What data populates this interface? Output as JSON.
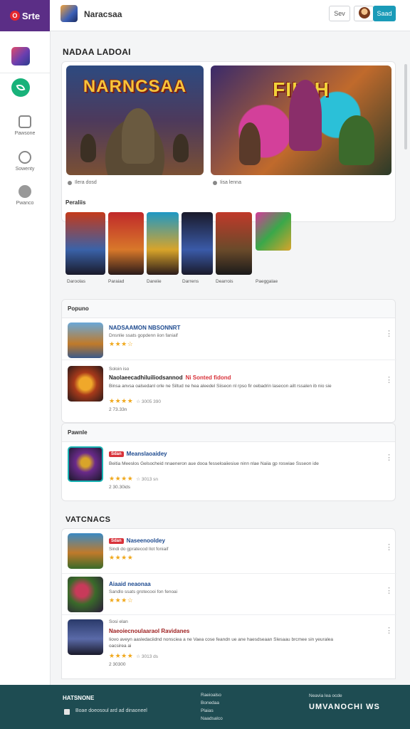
{
  "brand": {
    "name": "Srte",
    "mark": "O"
  },
  "header": {
    "app_name": "Naracsaa",
    "button_label": "Sev",
    "primary_label": "Saad"
  },
  "sidebar": {
    "items": [
      {
        "label": "Pawsone",
        "icon": "home-icon"
      },
      {
        "label": "Sowenty",
        "icon": "settings-icon"
      },
      {
        "label": "Pwanco",
        "icon": "chat-icon"
      }
    ]
  },
  "page": {
    "title": "NADAA LADOAI"
  },
  "hero": {
    "banner1_title": "NARNCSAA",
    "banner2_title": "FIIOH",
    "caption1": "Ilera dosd",
    "caption2": "Iisa lenna"
  },
  "popular_tiles": {
    "label": "Peraliis",
    "items": [
      {
        "caption": "Daroolas"
      },
      {
        "caption": "Paraiad"
      },
      {
        "caption": "Dareiie"
      },
      {
        "caption": "Darrens"
      },
      {
        "caption": "Dearrois"
      },
      {
        "caption": "Paeggalae"
      }
    ]
  },
  "section1": {
    "header": "Popuno",
    "rows": [
      {
        "title": "NADSAAMON NBSONNRT",
        "subtitle": "Dnsnlie ssats gopdenn iion faniaif",
        "stars": "★★★☆",
        "meta": ""
      },
      {
        "top_meta": "Soloin iso",
        "title": "Naolaeecadhiluiliodsannod",
        "title_badge": "Ni Sonted fidond",
        "desc": "Binsa anvsa oalsedanl orle ne Siltud ne hea aleedel Siiseon nl rpso fir oebadrin lasecon ailt rssalen ib nio sie",
        "stars": "★★★★",
        "meta": "☆ 3005 390",
        "foot": "2 73.33n"
      }
    ]
  },
  "section2": {
    "header": "Pawnle",
    "rows": [
      {
        "badge": "Sdan",
        "title": "Meanslaoaidey",
        "desc": "Beitia Meeslos Gelsocheid nnaeneron aue dooa fesseloaiiesiue ninn nlae Naiia gp roswiae Ssseon ide",
        "stars": "★★★★",
        "meta": "☆ 3013 sn",
        "foot": "2 30.30ids"
      }
    ]
  },
  "section3": {
    "label": "VATCNACS",
    "rows": [
      {
        "badge": "Sdan",
        "title": "Naseenooldey",
        "subtitle": "Sindi do gpratecod llot foniaif",
        "stars": "★★★★",
        "meta": ""
      },
      {
        "title": "Aiaaid neaonaa",
        "subtitle": "Sandlo ssats grotecooi fon fenoai",
        "stars": "★★★☆",
        "meta": ""
      },
      {
        "top_meta": "Sosi elan",
        "title": "Naeoiecnoulaaraol Ravidanes",
        "desc": "Iiovo aveyn aasledaciidnd nonsciea a ne Vaea cose feandn ue ane haesdseaan Slesaau brcmee sin yeuralea oacsirea ai",
        "stars": "★★★★",
        "meta": "☆ 3013 ds",
        "foot": "2 30300"
      }
    ]
  },
  "footer": {
    "heading": "HATSNONE",
    "checkbox_text": "Boae doeosoul ard ad dinaoneel",
    "links": [
      "Raeioalso",
      "Bonedaa",
      "Plaias",
      "Naadsalco"
    ],
    "right_small": "Neavia lea ocde",
    "right_big": "UMVANOCHI  WS"
  },
  "colors": {
    "brand": "#5b2e86",
    "accent": "#1a9bb8",
    "active": "#18b27a",
    "footer": "#1e4c52",
    "star": "#f0a81c"
  }
}
